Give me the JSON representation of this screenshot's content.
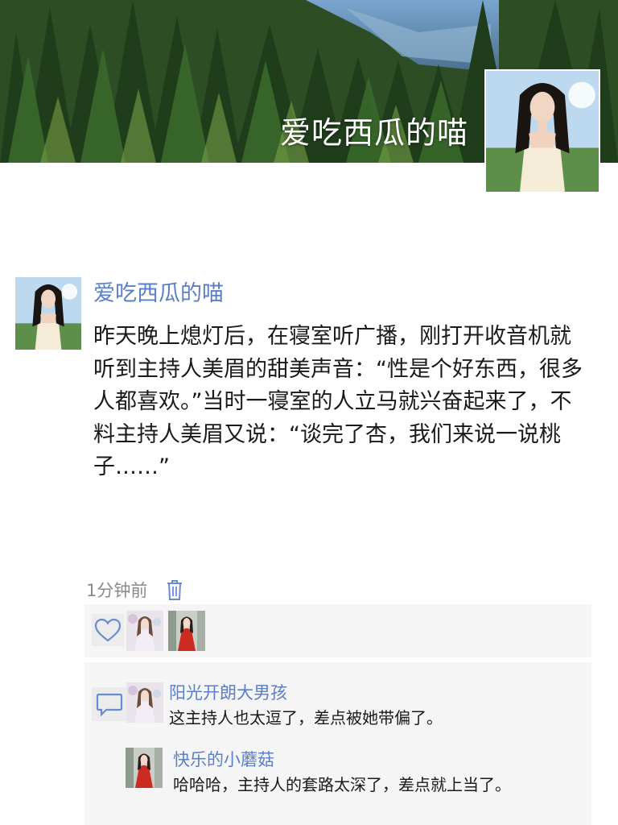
{
  "profile": {
    "nickname": "爱吃西瓜的喵",
    "cover_image": "forest-cover",
    "avatar_image": "girl-white-dress-portrait"
  },
  "post": {
    "author": "爱吃西瓜的喵",
    "body": "昨天晚上熄灯后，在寝室听广播，刚打开收音机就听到主持人美眉的甜美声音：“性是个好东西，很多人都喜欢。”当时一寝室的人立马就兴奋起来了，不料主持人美眉又说：“谈完了杏，我们来说一说桃子……”",
    "timestamp": "1分钟前",
    "delete_icon": "trash-icon"
  },
  "likes": {
    "icon": "heart-icon",
    "users": [
      "girl-floral-dress-avatar",
      "girl-red-dress-avatar"
    ]
  },
  "comments": {
    "icon": "comment-bubble-icon",
    "items": [
      {
        "author": "阳光开朗大男孩",
        "text": "这主持人也太逗了，差点被她带偏了。",
        "avatar": "girl-floral-dress-avatar"
      },
      {
        "author": "快乐的小蘑菇",
        "text": "哈哈哈，主持人的套路太深了，差点就上当了。",
        "avatar": "girl-red-dress-avatar"
      }
    ]
  },
  "colors": {
    "link_blue": "#5b7fc7",
    "panel_bg": "#f5f5f5",
    "text": "#1a1a1a",
    "muted": "#8a8a8a"
  }
}
